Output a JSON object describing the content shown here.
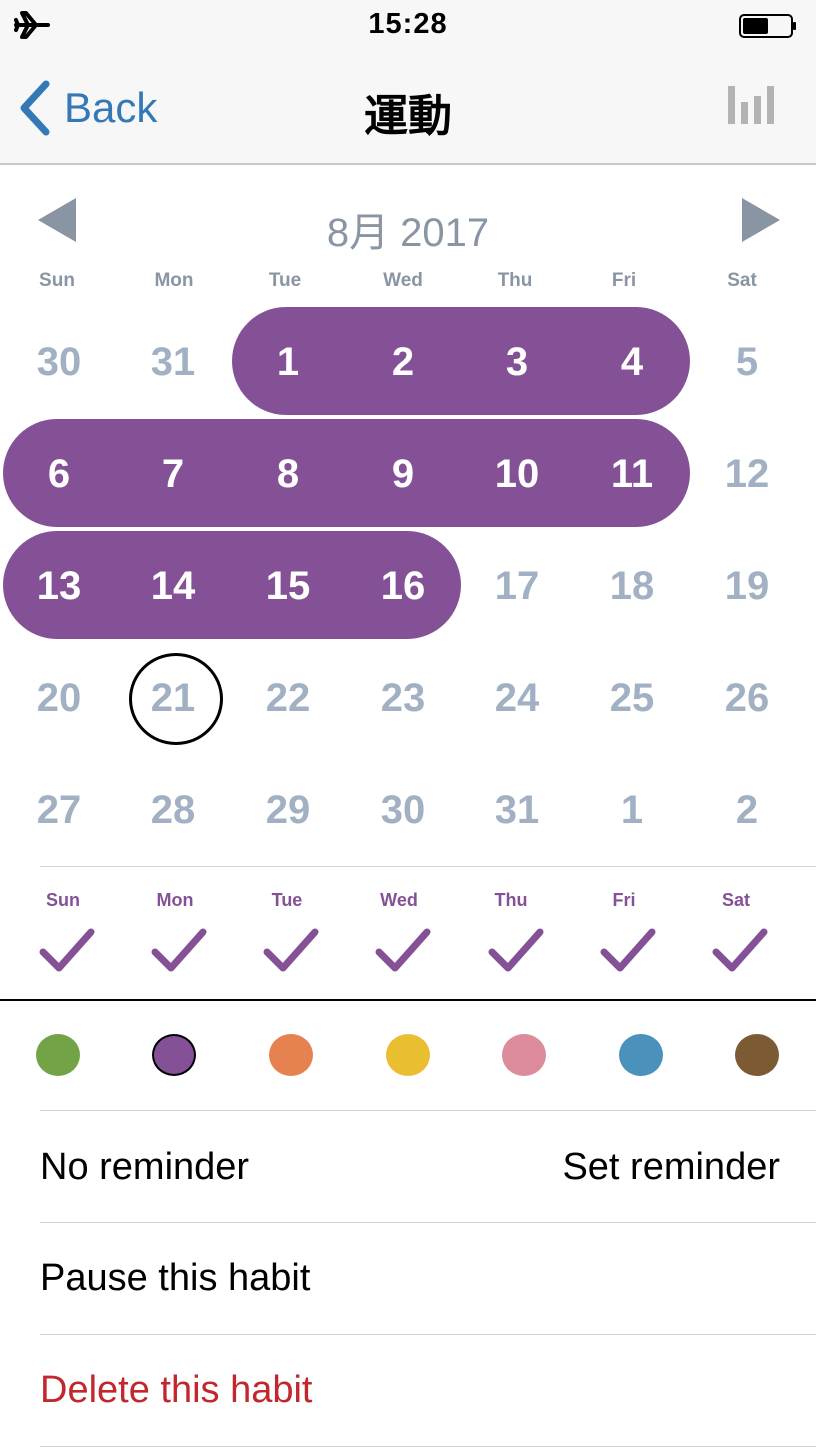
{
  "status_bar": {
    "time": "15:28",
    "left_icon": "airplane-icon",
    "right_icon": "battery-icon"
  },
  "nav": {
    "back_label": "Back",
    "title": "運動",
    "right_icon": "bar-chart-icon"
  },
  "calendar": {
    "month_title": "8月 2017",
    "prev_icon": "triangle-left-icon",
    "next_icon": "triangle-right-icon",
    "weekday_headers": [
      "Sun",
      "Mon",
      "Tue",
      "Wed",
      "Thu",
      "Fri",
      "Sat"
    ],
    "weeks": [
      [
        "30",
        "31",
        "1",
        "2",
        "3",
        "4",
        "5"
      ],
      [
        "6",
        "7",
        "8",
        "9",
        "10",
        "11",
        "12"
      ],
      [
        "13",
        "14",
        "15",
        "16",
        "17",
        "18",
        "19"
      ],
      [
        "20",
        "21",
        "22",
        "23",
        "24",
        "25",
        "26"
      ],
      [
        "27",
        "28",
        "29",
        "30",
        "31",
        "1",
        "2"
      ]
    ],
    "completed_days": [
      "1",
      "2",
      "3",
      "4",
      "6",
      "7",
      "8",
      "9",
      "10",
      "11",
      "13",
      "14",
      "15",
      "16"
    ],
    "today": "21",
    "highlight_color": "#855196"
  },
  "schedule": {
    "days": [
      "Sun",
      "Mon",
      "Tue",
      "Wed",
      "Thu",
      "Fri",
      "Sat"
    ],
    "checked": [
      true,
      true,
      true,
      true,
      true,
      true,
      true
    ],
    "check_icon": "checkmark-icon"
  },
  "colors": {
    "options": [
      "#72a447",
      "#855196",
      "#e6824f",
      "#e9bf31",
      "#db8b99",
      "#4a92bb",
      "#7c5a33"
    ],
    "selected_index": 1
  },
  "reminder": {
    "status": "No reminder",
    "action": "Set reminder"
  },
  "pause_label": "Pause this habit",
  "delete_label": "Delete this habit"
}
